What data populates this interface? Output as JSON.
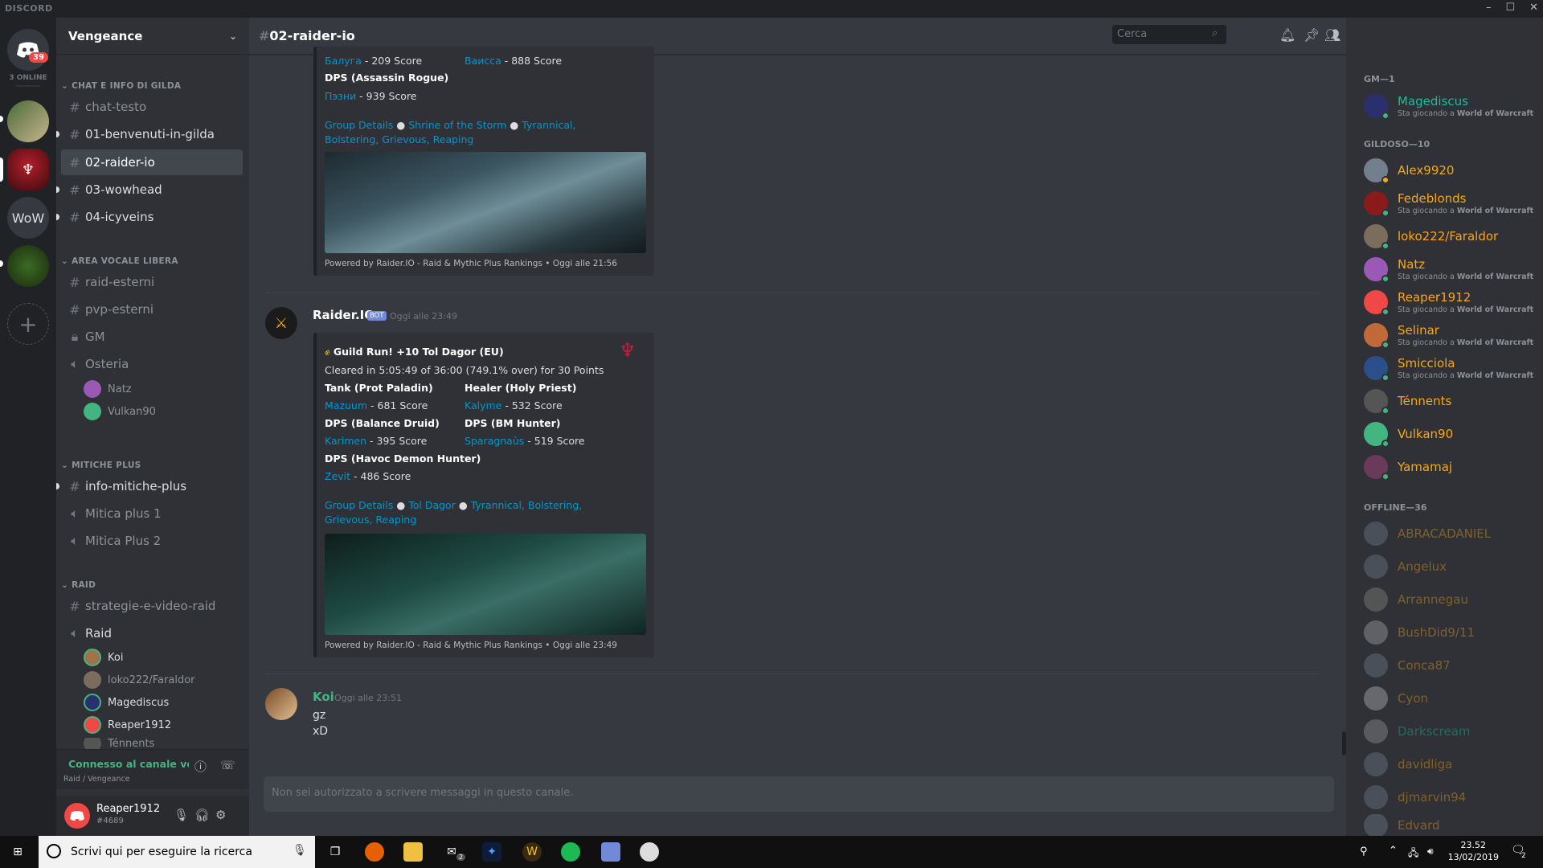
{
  "app": {
    "title": "DISCORD"
  },
  "window": {
    "minimize": "–",
    "maximize": "☐",
    "close": "✕"
  },
  "guilds": {
    "badge": "39",
    "online": "3 ONLINE",
    "wow": "WoW",
    "add": "+"
  },
  "server": {
    "name": "Vengeance"
  },
  "categories": [
    {
      "label": "CHAT E INFO DI GILDA"
    },
    {
      "label": "AREA VOCALE LIBERA"
    },
    {
      "label": "MITICHE PLUS"
    },
    {
      "label": "RAID"
    }
  ],
  "channels": [
    "chat-testo",
    "01-benvenuti-in-gilda",
    "02-raider-io",
    "03-wowhead",
    "04-icyveins",
    "raid-esterni",
    "pvp-esterni",
    "GM",
    "Osteria",
    "info-mitiche-plus",
    "Mitica plus 1",
    "Mitica Plus 2",
    "strategie-e-video-raid",
    "Raid"
  ],
  "voice_users": {
    "osteria": [
      "Natz",
      "Vulkan90"
    ],
    "raid": [
      "Koi",
      "loko222/Faraldor",
      "Magediscus",
      "Reaper1912",
      "Ténnents"
    ]
  },
  "voice_connection": {
    "status": "Connesso al canale vocale",
    "where": "Raid / Vengeance"
  },
  "user": {
    "name": "Reaper1912",
    "tag": "#4689"
  },
  "chat": {
    "channel": "02-raider-io",
    "search_placeholder": "Cerca",
    "input_placeholder": "Non sei autorizzato a scrivere messaggi in questo canale."
  },
  "embed1": {
    "line1_name": "Балуга",
    "line1_score": " - 209 Score",
    "line1b_name": "Ваисса",
    "line1b_score": " - 888 Score",
    "role": "DPS (Assassin Rogue)",
    "line2_name": "Пэзни",
    "line2_score": " - 939 Score",
    "links": "Group Details",
    "dungeon": "Shrine of the Storm",
    "affix1": "Tyrannical,",
    "affix2": "Bolstering, Grievous, Reaping",
    "footer": "Powered by Raider.IO - Raid & Mythic Plus Rankings",
    "footer_time": "Oggi alle 21:56"
  },
  "msg2": {
    "author": "Raider.IO",
    "bot": "BOT",
    "time": "Oggi alle 23:49",
    "title": "Guild Run! +10 Tol Dagor (EU)",
    "desc": "Cleared in 5:05:49 of 36:00 (749.1% over) for 30 Points",
    "tank_role": "Tank (Prot Paladin)",
    "tank_name": "Mazuum",
    "tank_score": " - 681 Score",
    "healer_role": "Healer (Holy Priest)",
    "healer_name": "Kalyme",
    "healer_score": " - 532 Score",
    "dps1_role": "DPS (Balance Druid)",
    "dps1_name": "Karimen",
    "dps1_score": " - 395 Score",
    "dps2_role": "DPS (BM Hunter)",
    "dps2_name": "Sparagnaùs",
    "dps2_score": " - 519 Score",
    "dps3_role": "DPS (Havoc Demon Hunter)",
    "dps3_name": "Zevit",
    "dps3_score": " - 486 Score",
    "links": "Group Details",
    "dungeon": "Tol Dagor",
    "affix1": "Tyrannical, Bolstering,",
    "affix2": "Grievous, Reaping",
    "footer": "Powered by Raider.IO - Raid & Mythic Plus Rankings",
    "footer_time": "Oggi alle 23:49"
  },
  "msg3": {
    "author": "Koi",
    "time": "Oggi alle 23:51",
    "line1": "gz",
    "line2": "xD"
  },
  "members": {
    "gm_header": "GM—1",
    "gm": [
      {
        "name": "Magediscus",
        "sub": "Sta giocando a ",
        "game": "World of Warcraft"
      }
    ],
    "gildoso_header": "GILDOSO—10",
    "gildoso": [
      {
        "name": "Alex9920",
        "sub": "",
        "game": ""
      },
      {
        "name": "Fedeblonds",
        "sub": "Sta giocando a ",
        "game": "World of Warcraft"
      },
      {
        "name": "loko222/Faraldor",
        "sub": "",
        "game": ""
      },
      {
        "name": "Natz",
        "sub": "Sta giocando a ",
        "game": "World of Warcraft"
      },
      {
        "name": "Reaper1912",
        "sub": "Sta giocando a ",
        "game": "World of Warcraft"
      },
      {
        "name": "Selinar",
        "sub": "Sta giocando a ",
        "game": "World of Warcraft"
      },
      {
        "name": "Smicciola",
        "sub": "Sta giocando a ",
        "game": "World of Warcraft"
      },
      {
        "name": "Ténnents",
        "sub": "",
        "game": ""
      },
      {
        "name": "Vulkan90",
        "sub": "",
        "game": ""
      },
      {
        "name": "Yamamaj",
        "sub": "",
        "game": ""
      }
    ],
    "offline_header": "OFFLINE—36",
    "offline": [
      "ABRACADANIEL",
      "Angelux",
      "Arrannegau",
      "BushDid9/11",
      "Conca87",
      "Cyon",
      "Darkscream",
      "davidliga",
      "djmarvin94",
      "Edvard"
    ]
  },
  "taskbar": {
    "search_placeholder": "Scrivi qui per eseguire la ricerca",
    "time": "23.52",
    "date": "13/02/2019",
    "notif": "2",
    "mail_badge": "2"
  },
  "colors": {
    "accent": "#7289da",
    "link": "#0096cf",
    "online": "#43b581",
    "gold": "#faa61a",
    "gm": "#1abc9c"
  }
}
